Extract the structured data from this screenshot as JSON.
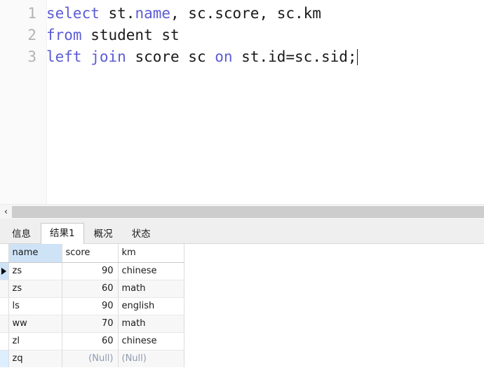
{
  "editor": {
    "lines": [
      {
        "number": "1",
        "tokens": [
          {
            "t": "select",
            "kw": true
          },
          {
            "t": " st.",
            "kw": false
          },
          {
            "t": "name",
            "kw": true
          },
          {
            "t": ", sc.score, sc.km",
            "kw": false
          }
        ]
      },
      {
        "number": "2",
        "tokens": [
          {
            "t": "from",
            "kw": true
          },
          {
            "t": " student st",
            "kw": false
          }
        ]
      },
      {
        "number": "3",
        "tokens": [
          {
            "t": "left join",
            "kw": true
          },
          {
            "t": " score sc ",
            "kw": false
          },
          {
            "t": "on",
            "kw": true
          },
          {
            "t": " st.id=sc.sid;",
            "kw": false
          }
        ]
      }
    ],
    "caret_line": 3,
    "keyword_color": "#5b5bd6",
    "text_color": "#1a1a1a",
    "linenumber_color": "#b3b3b3"
  },
  "scrollbar": {
    "left_button_glyph": "‹",
    "thumb_color": "#cdcdcd"
  },
  "tabs": [
    {
      "label": "信息",
      "active": false
    },
    {
      "label": "结果1",
      "active": true
    },
    {
      "label": "概况",
      "active": false
    },
    {
      "label": "状态",
      "active": false
    }
  ],
  "grid": {
    "columns": [
      "name",
      "score",
      "km"
    ],
    "selected_column": "name",
    "selected_header_color": "#cfe3f7",
    "current_row_index": 0,
    "rows": [
      {
        "name": "zs",
        "score": "90",
        "km": "chinese",
        "partial": false
      },
      {
        "name": "zs",
        "score": "60",
        "km": "math",
        "partial": false
      },
      {
        "name": "ls",
        "score": "90",
        "km": "english",
        "partial": false
      },
      {
        "name": "ww",
        "score": "70",
        "km": "math",
        "partial": false
      },
      {
        "name": "zl",
        "score": "60",
        "km": "chinese",
        "partial": false
      },
      {
        "name": "zq",
        "score": "(Null)",
        "km": "(Null)",
        "partial": true
      }
    ]
  }
}
